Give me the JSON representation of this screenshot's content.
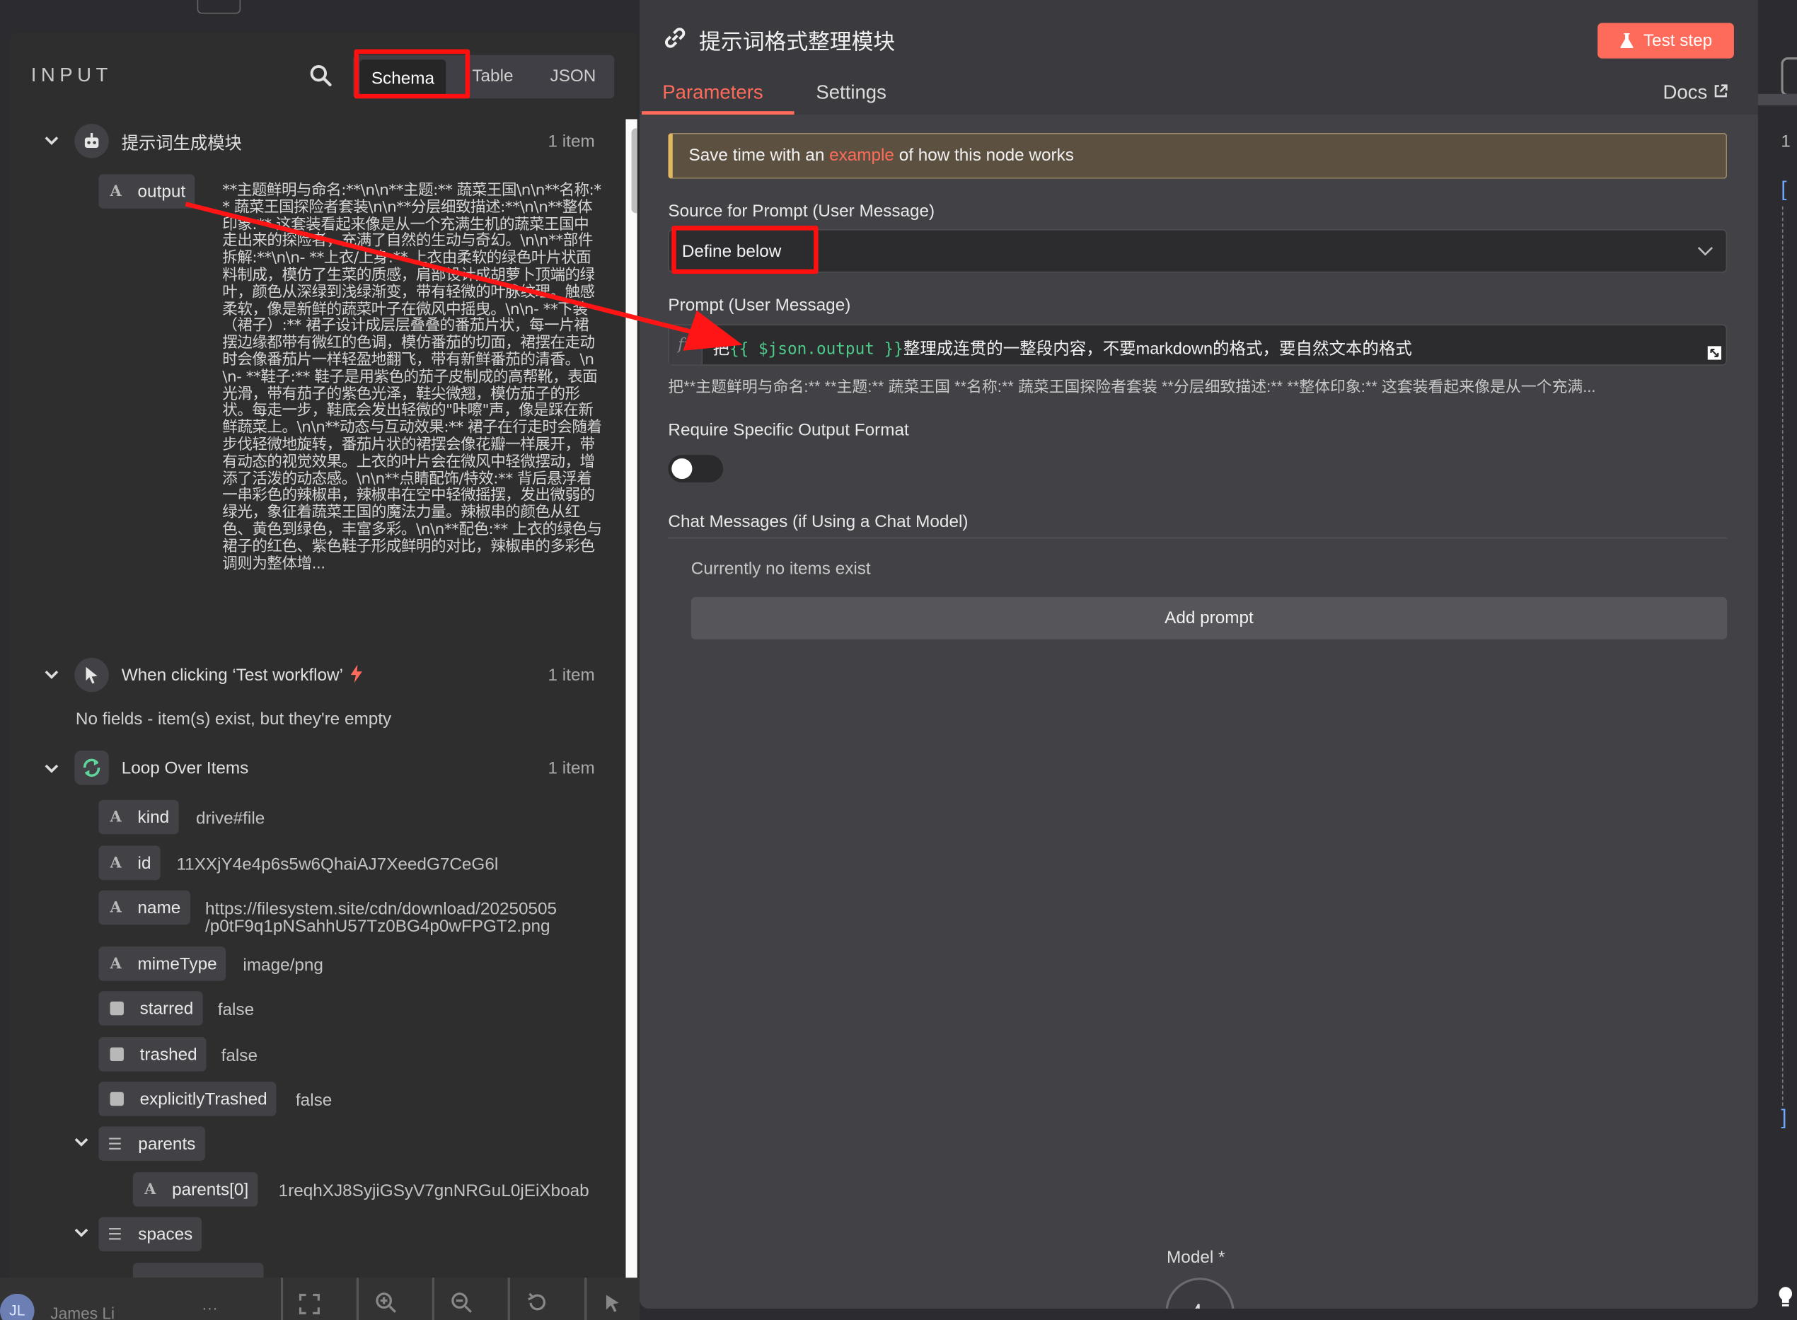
{
  "input_panel": {
    "title": "INPUT",
    "modes": [
      "Schema",
      "Table",
      "JSON"
    ],
    "active_mode": "Schema",
    "nodes": [
      {
        "name": "提示词生成模块",
        "count": "1 item",
        "fields": [
          {
            "type": "A",
            "key": "output",
            "value": "**主题鲜明与命名:**\\n\\n**主题:** 蔬菜王国\\n\\n**名称:** 蔬菜王国探险者套装\\n\\n**分层细致描述:**\\n\\n**整体印象:** 这套装看起来像是从一个充满生机的蔬菜王国中走出来的探险者，充满了自然的生动与奇幻。\\n\\n**部件拆解:**\\n\\n- **上衣/上身:** 上衣由柔软的绿色叶片状面料制成，模仿了生菜的质感，肩部设计成胡萝卜顶端的绿叶，颜色从深绿到浅绿渐变，带有轻微的叶脉纹理。触感柔软，像是新鲜的蔬菜叶子在微风中摇曳。\\n\\n- **下装（裙子）:** 裙子设计成层层叠叠的番茄片状，每一片裙摆边缘都带有微红的色调，模仿番茄的切面，裙摆在走动时会像番茄片一样轻盈地翻飞，带有新鲜番茄的清香。\\n\\n- **鞋子:** 鞋子是用紫色的茄子皮制成的高帮靴，表面光滑，带有茄子的紫色光泽，鞋尖微翘，模仿茄子的形状。每走一步，鞋底会发出轻微的\"咔嚓\"声，像是踩在新鲜蔬菜上。\\n\\n**动态与互动效果:** 裙子在行走时会随着步伐轻微地旋转，番茄片状的裙摆会像花瓣一样展开，带有动态的视觉效果。上衣的叶片会在微风中轻微摆动，增添了活泼的动态感。\\n\\n**点睛配饰/特效:** 背后悬浮着一串彩色的辣椒串，辣椒串在空中轻微摇摆，发出微弱的绿光，象征着蔬菜王国的魔法力量。辣椒串的颜色从红色、黄色到绿色，丰富多彩。\\n\\n**配色:** 上衣的绿色与裙子的红色、紫色鞋子形成鲜明的对比，辣椒串的多彩色调则为整体增..."
          }
        ]
      },
      {
        "name": "When clicking ‘Test workflow’",
        "count": "1 item",
        "empty_note": "No fields - item(s) exist, but they're empty"
      },
      {
        "name": "Loop Over Items",
        "count": "1 item",
        "fields": [
          {
            "type": "A",
            "key": "kind",
            "value": "drive#file"
          },
          {
            "type": "A",
            "key": "id",
            "value": "11XXjY4e4p6s5w6QhaiAJ7XeedG7CeG6l"
          },
          {
            "type": "A",
            "key": "name",
            "value_line1": "https://filesystem.site/cdn/download/20250505",
            "value_line2": "/p0tF9q1pNSahhU57Tz0BG4p0wFPGT2.png"
          },
          {
            "type": "A",
            "key": "mimeType",
            "value": "image/png"
          },
          {
            "type": "bool",
            "key": "starred",
            "value": "false"
          },
          {
            "type": "bool",
            "key": "trashed",
            "value": "false"
          },
          {
            "type": "bool",
            "key": "explicitlyTrashed",
            "value": "false"
          },
          {
            "type": "list",
            "key": "parents"
          },
          {
            "type": "A",
            "key": "parents[0]",
            "value": "1reqhXJ8SyjiGSyV7gnNRGuL0jEiXboab"
          },
          {
            "type": "list",
            "key": "spaces"
          }
        ]
      }
    ]
  },
  "node_panel": {
    "title": "提示词格式整理模块",
    "test_step_label": "Test step",
    "tabs": [
      "Parameters",
      "Settings"
    ],
    "active_tab": "Parameters",
    "docs_label": "Docs",
    "banner": {
      "before": "Save time with an ",
      "link": "example",
      "after": " of how this node works"
    },
    "source_label": "Source for Prompt (User Message)",
    "source_value": "Define below",
    "prompt_label": "Prompt (User Message)",
    "prompt_expr": {
      "prefix": "把",
      "expr": "{{ $json.output }}",
      "suffix": "整理成连贯的一整段内容，不要markdown的格式，要自然文本的格式"
    },
    "prompt_preview": "把**主题鲜明与命名:** **主题:** 蔬菜王国 **名称:** 蔬菜王国探险者套装 **分层细致描述:** **整体印象:** 这套装看起来像是从一个充满...",
    "output_format_label": "Require Specific Output Format",
    "output_format_enabled": false,
    "chat_label": "Chat Messages (if Using a Chat Model)",
    "chat_empty": "Currently no items exist",
    "add_prompt_label": "Add prompt",
    "model_label": "Model *"
  },
  "bottom_bar": {
    "user": "James Li",
    "initials": "JL"
  },
  "colors": {
    "accent": "#ff6b5a",
    "highlight": "#ff1010",
    "panel": "#414146",
    "expr_green": "#4fc98a"
  }
}
